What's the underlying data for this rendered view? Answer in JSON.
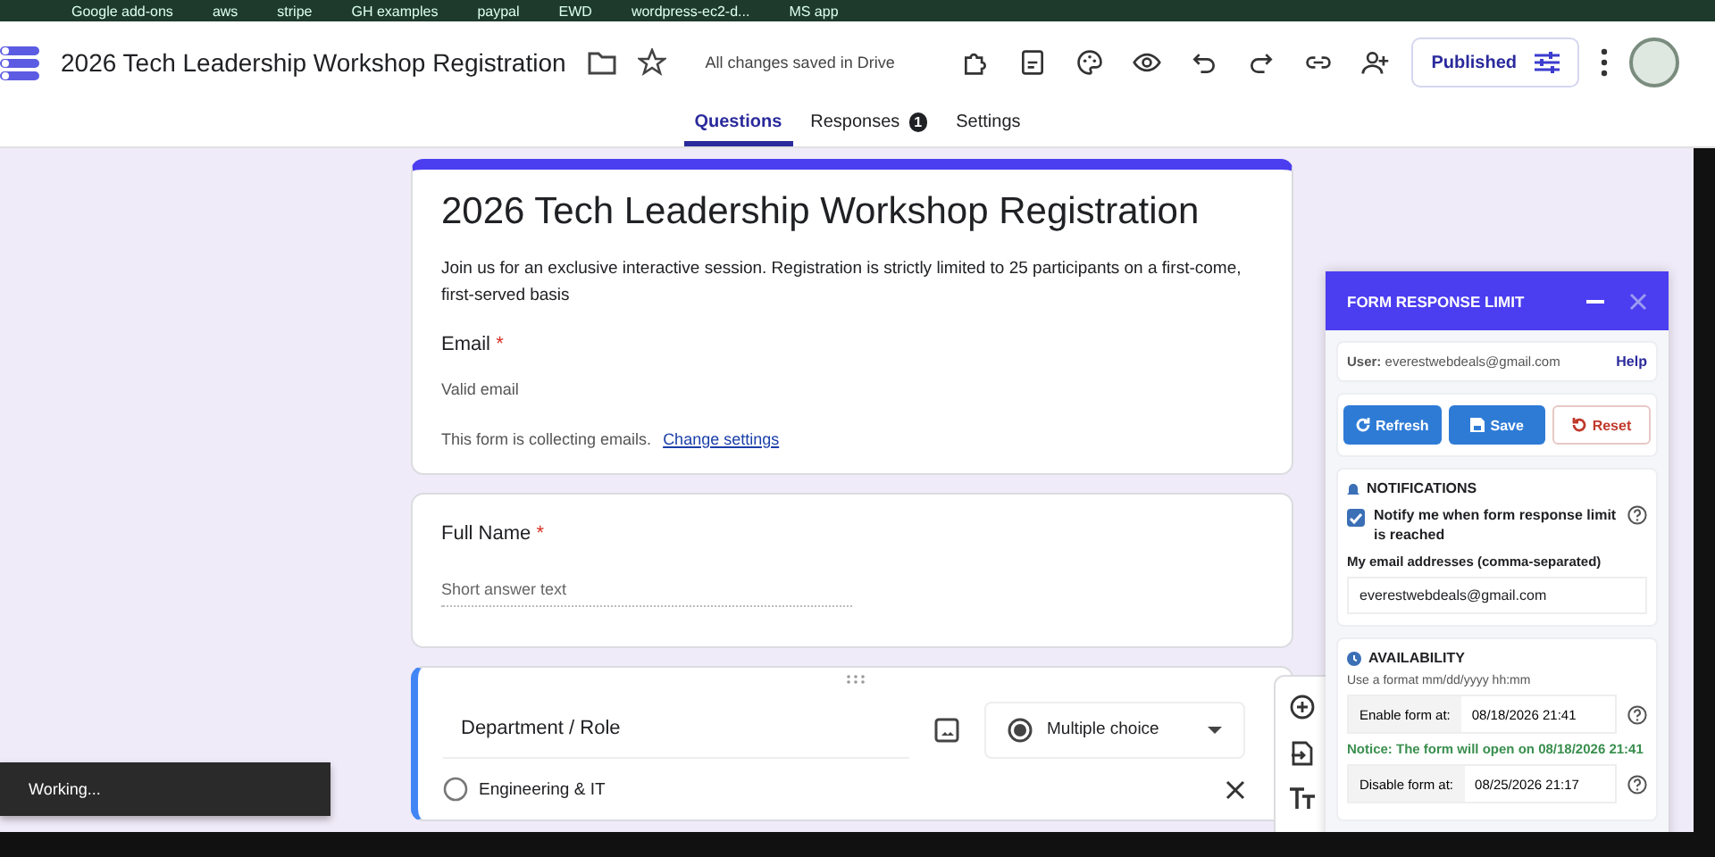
{
  "bookmarks": [
    {
      "label": "Google add-ons"
    },
    {
      "label": "aws"
    },
    {
      "label": "stripe"
    },
    {
      "label": "GH examples"
    },
    {
      "label": "paypal"
    },
    {
      "label": "EWD"
    },
    {
      "label": "wordpress-ec2-d..."
    },
    {
      "label": "MS app"
    }
  ],
  "app": {
    "title": "2026 Tech Leadership Workshop Registration",
    "save_status": "All changes saved in Drive",
    "publish_label": "Published"
  },
  "tabs": [
    {
      "label": "Questions",
      "selected": true
    },
    {
      "label": "Responses",
      "selected": false,
      "badge": "1"
    },
    {
      "label": "Settings",
      "selected": false
    }
  ],
  "form": {
    "title": "2026 Tech Leadership Workshop Registration",
    "description": "Join us for an exclusive interactive session. Registration is strictly limited to 25 participants on a first-come, first-served basis",
    "email_label": "Email",
    "email_required_mark": "*",
    "email_hint": "Valid email",
    "collecting_note": "This form is collecting emails.",
    "change_link": "Change settings"
  },
  "questions": [
    {
      "kind": "short",
      "title": "Full Name",
      "required_mark": "*",
      "placeholder": "Short answer text"
    },
    {
      "kind": "choice",
      "title": "Department / Role",
      "type_label": "Multiple choice",
      "options": [
        {
          "label": "Engineering & IT"
        }
      ]
    }
  ],
  "toast": {
    "text": "Working..."
  },
  "panel": {
    "title": "FORM RESPONSE LIMIT",
    "user_label": "User:",
    "user_email": "everestwebdeals@gmail.com",
    "help": "Help",
    "buttons": [
      {
        "label": "Refresh",
        "kind": "refresh"
      },
      {
        "label": "Save",
        "kind": "save"
      },
      {
        "label": "Reset",
        "kind": "reset"
      }
    ],
    "notifications": {
      "heading": "NOTIFICATIONS",
      "notify_label": "Notify me when form response limit is reached",
      "checked": true,
      "emails_label": "My email addresses (comma-separated)",
      "emails_value": "everestwebdeals@gmail.com"
    },
    "availability": {
      "heading": "AVAILABILITY",
      "hint": "Use a format mm/dd/yyyy hh:mm",
      "items": [
        {
          "kind": "field",
          "label": "Enable form at:",
          "value": "08/18/2026 21:41"
        },
        {
          "kind": "notice",
          "text": "Notice: The form will open on 08/18/2026 21:41"
        },
        {
          "kind": "field",
          "label": "Disable form at:",
          "value": "08/25/2026 21:17"
        }
      ]
    }
  }
}
